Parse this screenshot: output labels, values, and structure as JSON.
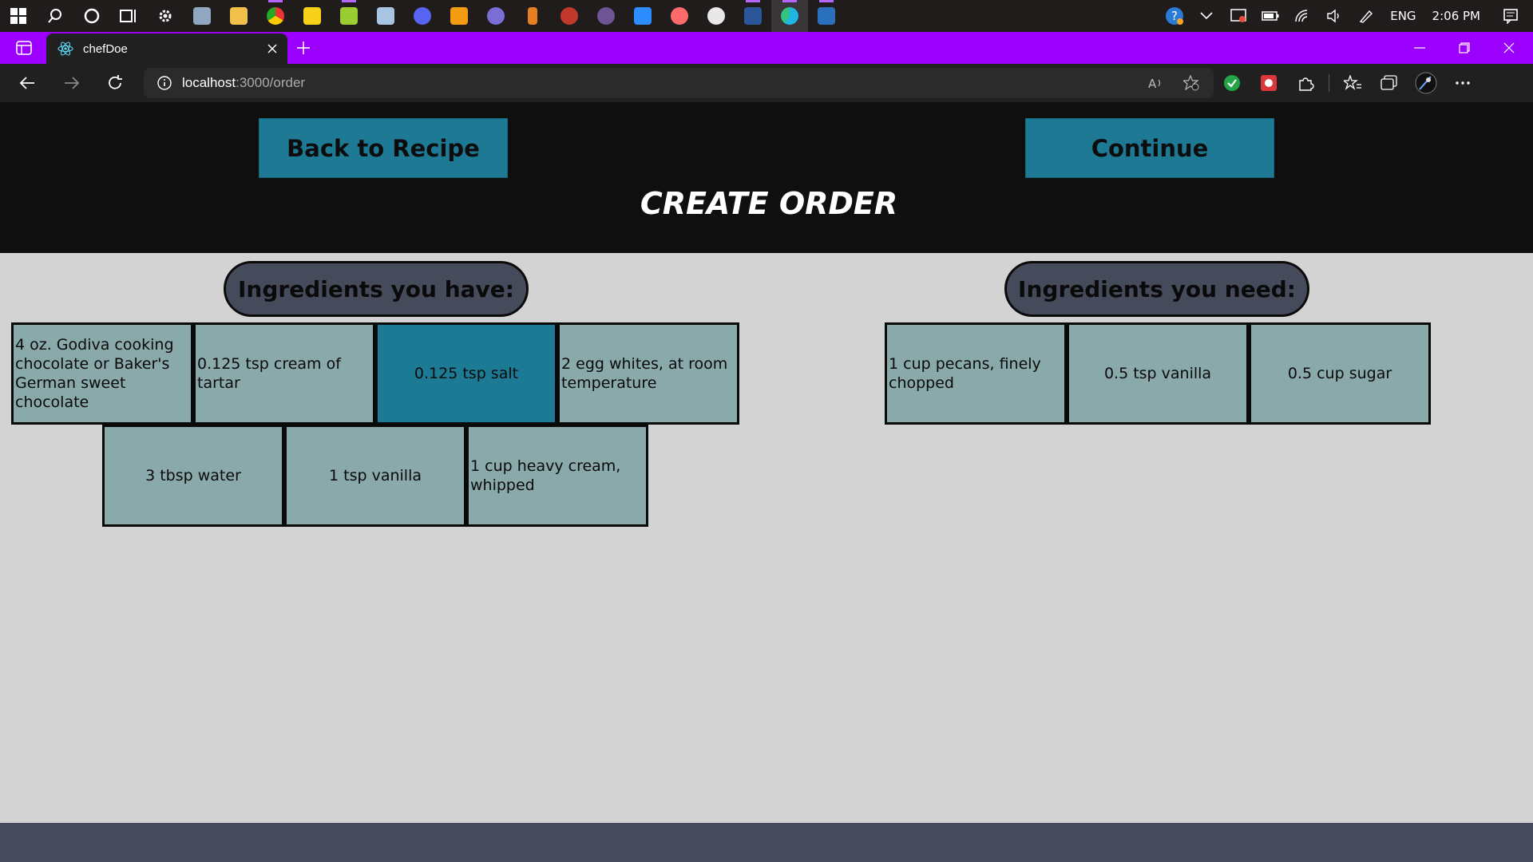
{
  "taskbar": {
    "tray": {
      "language": "ENG",
      "time": "2:06 PM"
    }
  },
  "browser": {
    "tab_title": "chefDoe",
    "url_host": "localhost",
    "url_path": ":3000/order"
  },
  "page": {
    "back_button": "Back to Recipe",
    "continue_button": "Continue",
    "title": "CREATE ORDER",
    "have_header": "Ingredients you have:",
    "need_header": "Ingredients you need:",
    "have_items": [
      "4 oz. Godiva cooking chocolate or Baker's German sweet chocolate",
      "0.125 tsp cream of tartar",
      "0.125 tsp salt",
      "2 egg whites, at room temperature",
      "3 tbsp water",
      "1 tsp vanilla",
      "1 cup heavy cream, whipped"
    ],
    "need_items": [
      "1 cup pecans, finely chopped",
      "0.5 tsp vanilla",
      "0.5 cup sugar"
    ]
  },
  "colors": {
    "accent": "#1e7a94",
    "card": "#8aa9aa",
    "pill": "#464b5c",
    "tabbar": "#9b00ff"
  }
}
